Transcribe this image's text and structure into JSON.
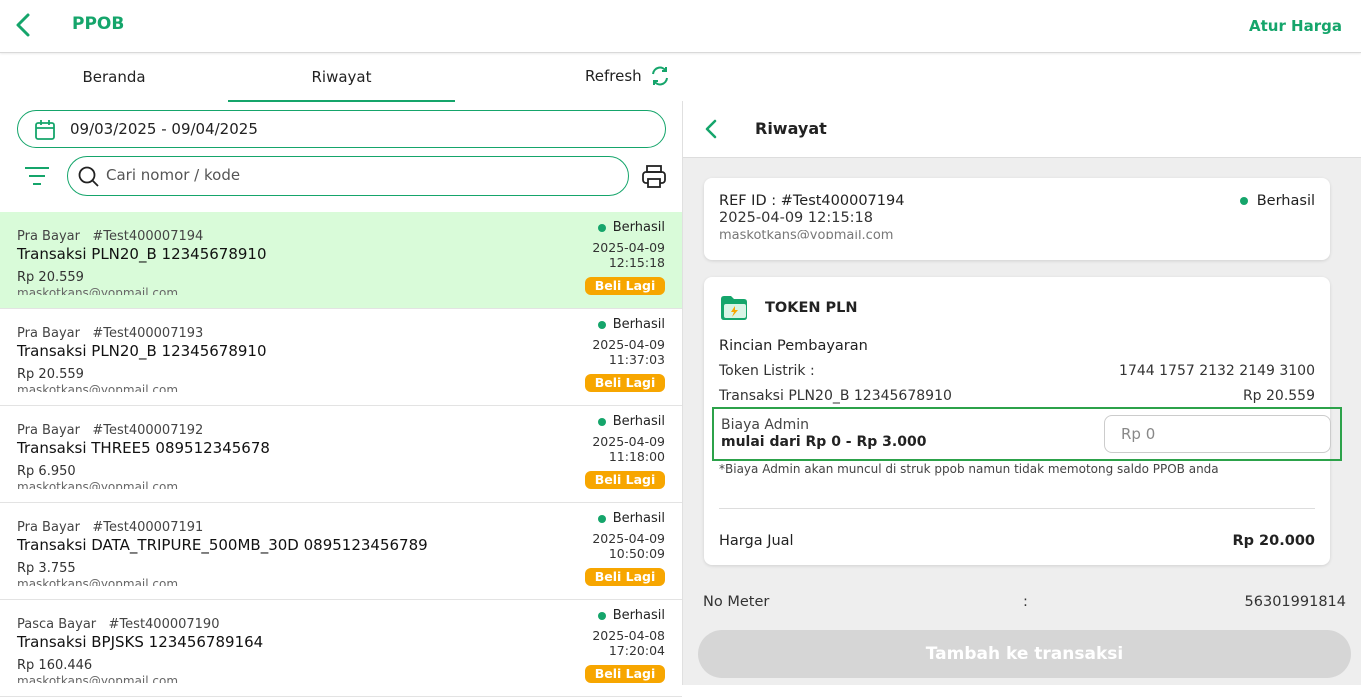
{
  "header": {
    "title": "PPOB",
    "action": "Atur Harga"
  },
  "tabs": {
    "beranda": "Beranda",
    "riwayat": "Riwayat",
    "refresh": "Refresh"
  },
  "filters": {
    "date_range": "09/03/2025 - 09/04/2025",
    "search_placeholder": "Cari nomor / kode"
  },
  "transactions": [
    {
      "type": "Pra Bayar",
      "ref": "#Test400007194",
      "name": "Transaksi PLN20_B 12345678910",
      "price": "Rp 20.559",
      "email": "maskotkans@yopmail.com",
      "status": "Berhasil",
      "date": "2025-04-09",
      "time": "12:15:18",
      "action": "Beli Lagi"
    },
    {
      "type": "Pra Bayar",
      "ref": "#Test400007193",
      "name": "Transaksi PLN20_B 12345678910",
      "price": "Rp 20.559",
      "email": "maskotkans@yopmail.com",
      "status": "Berhasil",
      "date": "2025-04-09",
      "time": "11:37:03",
      "action": "Beli Lagi"
    },
    {
      "type": "Pra Bayar",
      "ref": "#Test400007192",
      "name": "Transaksi THREE5 089512345678",
      "price": "Rp 6.950",
      "email": "maskotkans@yopmail.com",
      "status": "Berhasil",
      "date": "2025-04-09",
      "time": "11:18:00",
      "action": "Beli Lagi"
    },
    {
      "type": "Pra Bayar",
      "ref": "#Test400007191",
      "name": "Transaksi DATA_TRIPURE_500MB_30D 0895123456789",
      "price": "Rp 3.755",
      "email": "maskotkans@yopmail.com",
      "status": "Berhasil",
      "date": "2025-04-09",
      "time": "10:50:09",
      "action": "Beli Lagi"
    },
    {
      "type": "Pasca Bayar",
      "ref": "#Test400007190",
      "name": "Transaksi BPJSKS 123456789164",
      "price": "Rp 160.446",
      "email": "maskotkans@yopmail.com",
      "status": "Berhasil",
      "date": "2025-04-08",
      "time": "17:20:04",
      "action": "Beli Lagi"
    }
  ],
  "detail": {
    "title": "Riwayat",
    "ref_line": "REF ID : #Test400007194",
    "datetime": "2025-04-09 12:15:18",
    "email": "maskotkans@yopmail.com",
    "status": "Berhasil",
    "product": "TOKEN PLN",
    "rincian": "Rincian Pembayaran",
    "token_label": "Token Listrik :",
    "token_value": "1744 1757 2132 2149 3100",
    "trx_label": "Transaksi PLN20_B 12345678910",
    "trx_value": "Rp 20.559",
    "admin_label": "Biaya Admin",
    "admin_range": "mulai dari Rp 0 - Rp 3.000",
    "admin_placeholder": "Rp 0",
    "note": "*Biaya Admin akan muncul di struk ppob namun tidak memotong saldo PPOB anda",
    "harga_label": "Harga Jual",
    "harga_value": "Rp 20.000",
    "meter_label": "No Meter",
    "meter_colon": ":",
    "meter_value": "56301991814",
    "submit": "Tambah ke transaksi"
  },
  "colors": {
    "brand": "#15a56b",
    "accent": "#f7a600",
    "active_row": "#d9fbd9"
  }
}
